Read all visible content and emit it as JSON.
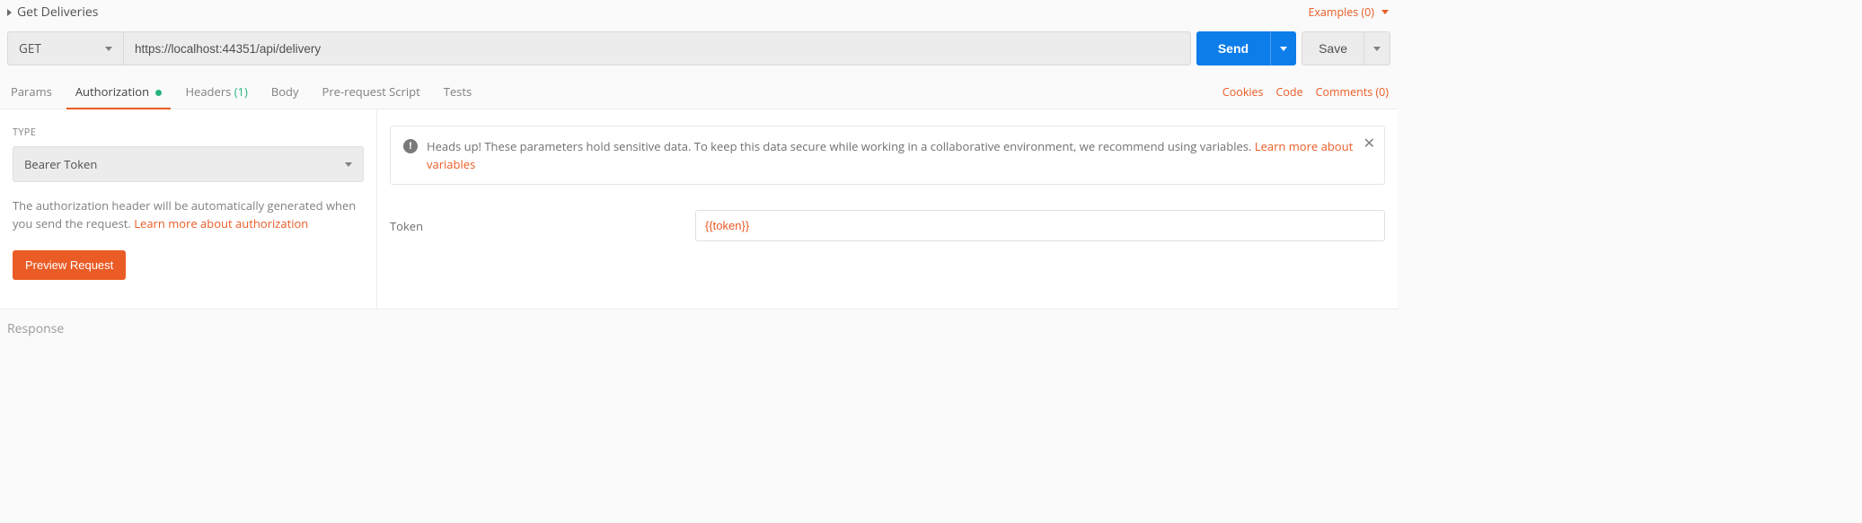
{
  "header": {
    "title": "Get Deliveries",
    "examples_label": "Examples (0)"
  },
  "request": {
    "method": "GET",
    "url": "https://localhost:44351/api/delivery",
    "send_label": "Send",
    "save_label": "Save"
  },
  "tabs": {
    "params": "Params",
    "authorization": "Authorization",
    "headers": "Headers",
    "headers_count": "(1)",
    "body": "Body",
    "prerequest": "Pre-request Script",
    "tests": "Tests"
  },
  "right_links": {
    "cookies": "Cookies",
    "code": "Code",
    "comments": "Comments (0)"
  },
  "auth_panel": {
    "type_label": "TYPE",
    "type_value": "Bearer Token",
    "help_text": "The authorization header will be automatically generated when you send the request. ",
    "help_link": "Learn more about authorization",
    "preview_label": "Preview Request"
  },
  "banner": {
    "text": "Heads up! These parameters hold sensitive data. To keep this data secure while working in a collaborative environment, we recommend using variables. ",
    "link": "Learn more about variables"
  },
  "token": {
    "label": "Token",
    "value": "{{token}}"
  },
  "response": {
    "title": "Response"
  }
}
